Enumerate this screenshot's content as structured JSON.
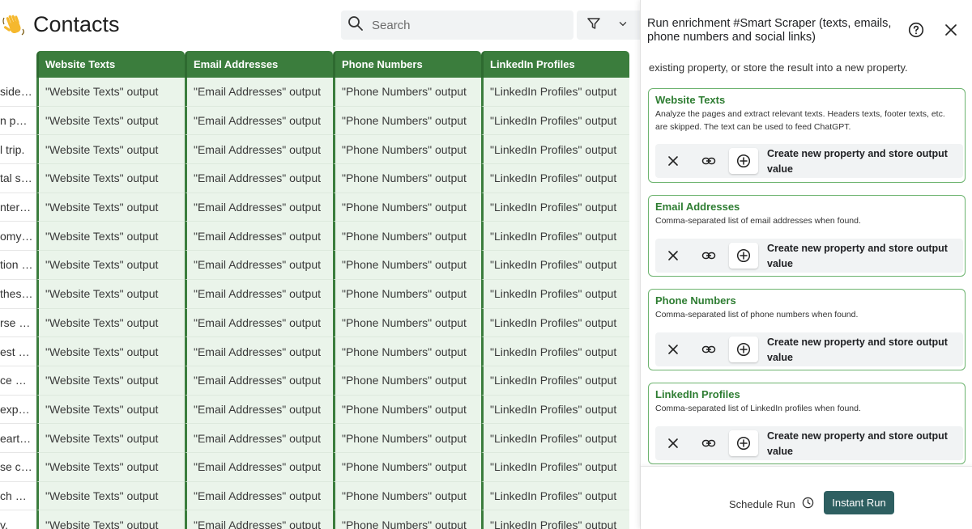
{
  "header": {
    "title": "Contacts",
    "emoji": "👋",
    "search_placeholder": "Search"
  },
  "table": {
    "columns": [
      "Website Texts",
      "Email Addresses",
      "Phone Numbers",
      "LinkedIn Profiles"
    ],
    "first_col_cells": [
      "side e…",
      "n par…",
      "l trip.",
      "tal si…",
      "nter j…",
      "omy …",
      "tion …",
      "thes…",
      "rse s…",
      "est o…",
      "ce m…",
      "expe…",
      "eart …",
      "se ce…",
      "ch m…",
      "y."
    ],
    "output_cells": [
      "\"Website Texts\" output",
      "\"Email Addresses\" output",
      "\"Phone Numbers\" output",
      "\"LinkedIn Profiles\" output"
    ]
  },
  "panel": {
    "title": "Run enrichment #Smart Scraper (texts, emails, phone numbers and social links)",
    "intro": "existing property, or store the result into a new property.",
    "cards": [
      {
        "title": "Website Texts",
        "desc": "Analyze the pages and extract relevant texts. Headers texts, footer texts, etc. are skipped. The text can be used to feed ChatGPT.",
        "action": "Create new property and store output value"
      },
      {
        "title": "Email Addresses",
        "desc": "Comma-separated list of email addresses when found.",
        "action": "Create new property and store output value"
      },
      {
        "title": "Phone Numbers",
        "desc": "Comma-separated list of phone numbers when found.",
        "action": "Create new property and store output value"
      },
      {
        "title": "LinkedIn Profiles",
        "desc": "Comma-separated list of LinkedIn profiles when found.",
        "action": "Create new property and store output value"
      }
    ],
    "schedule_label": "Schedule Run",
    "instant_label": "Instant Run"
  },
  "colors": {
    "header_green": "#3b7d3d",
    "cell_green": "#eaf4ea",
    "card_title_green": "#2e7d32",
    "primary_button": "#2e5f61"
  }
}
